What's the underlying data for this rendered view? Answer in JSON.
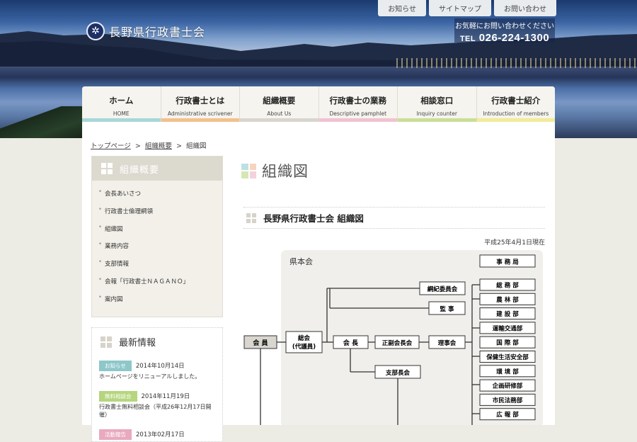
{
  "site": {
    "name": "長野県行政書士会",
    "logo_mark": "✲"
  },
  "util_nav": [
    "お知らせ",
    "サイトマップ",
    "お問い合わせ"
  ],
  "tel": {
    "lead": "お気軽にお問い合わせください",
    "prefix": "TEL",
    "number": "026-224-1300"
  },
  "global_nav": [
    {
      "jp": "ホーム",
      "en": "HOME",
      "color": "#a7d7d9"
    },
    {
      "jp": "行政書士とは",
      "en": "Administrative scrivener",
      "color": "#f3c08c"
    },
    {
      "jp": "組織概要",
      "en": "About Us",
      "color": "#d8d5cc"
    },
    {
      "jp": "行政書士の業務",
      "en": "Descriptive pamphlet",
      "color": "#f1c2d2"
    },
    {
      "jp": "相談窓口",
      "en": "Inquiry counter",
      "color": "#c9df97"
    },
    {
      "jp": "行政書士紹介",
      "en": "Introduction of members",
      "color": "#f2eb97"
    }
  ],
  "breadcrumb": {
    "top": "トップページ",
    "parent": "組織概要",
    "current": "組織図",
    "sep": ">"
  },
  "sidebar": {
    "title": "組織概要",
    "items": [
      "会長あいさつ",
      "行政書士倫理綱領",
      "組織図",
      "業務内容",
      "支部情報",
      "会報「行政書士ＮＡＧＡＮＯ」",
      "案内図"
    ]
  },
  "news": {
    "title": "最新情報",
    "items": [
      {
        "badge": "お知らせ",
        "badge_color": "#8dc7c9",
        "date": "2014年10月14日",
        "text": "ホームページをリニューアルしました。"
      },
      {
        "badge": "無料相談会",
        "badge_color": "#b5d57e",
        "date": "2014年11月19日",
        "text": "行政書士無料相談会（平成26年12月17日開催）"
      },
      {
        "badge": "活動報告",
        "badge_color": "#e9a9be",
        "date": "2013年02月17日",
        "text": ""
      }
    ]
  },
  "page": {
    "title": "組織図",
    "section_title": "長野県行政書士会 組織図",
    "as_of": "平成25年4月1日現在"
  },
  "org_chart": {
    "region_label": "県本会",
    "kaiin": "会 員",
    "sokai": [
      "総会",
      "(代議員)"
    ],
    "kaicho": "会 長",
    "fuku": "正副会長会",
    "rijikai": "理事会",
    "kouki": "綱紀委員会",
    "kanji": "監 事",
    "shibu": "支部長会",
    "jimukyoku": "事 務 局",
    "departments": [
      "総 務 部",
      "農 林 部",
      "建 設 部",
      "運輸交通部",
      "国 際 部",
      "保健生活安全部",
      "環 境 部",
      "企画研修部",
      "市民法務部",
      "広 報 部"
    ]
  }
}
